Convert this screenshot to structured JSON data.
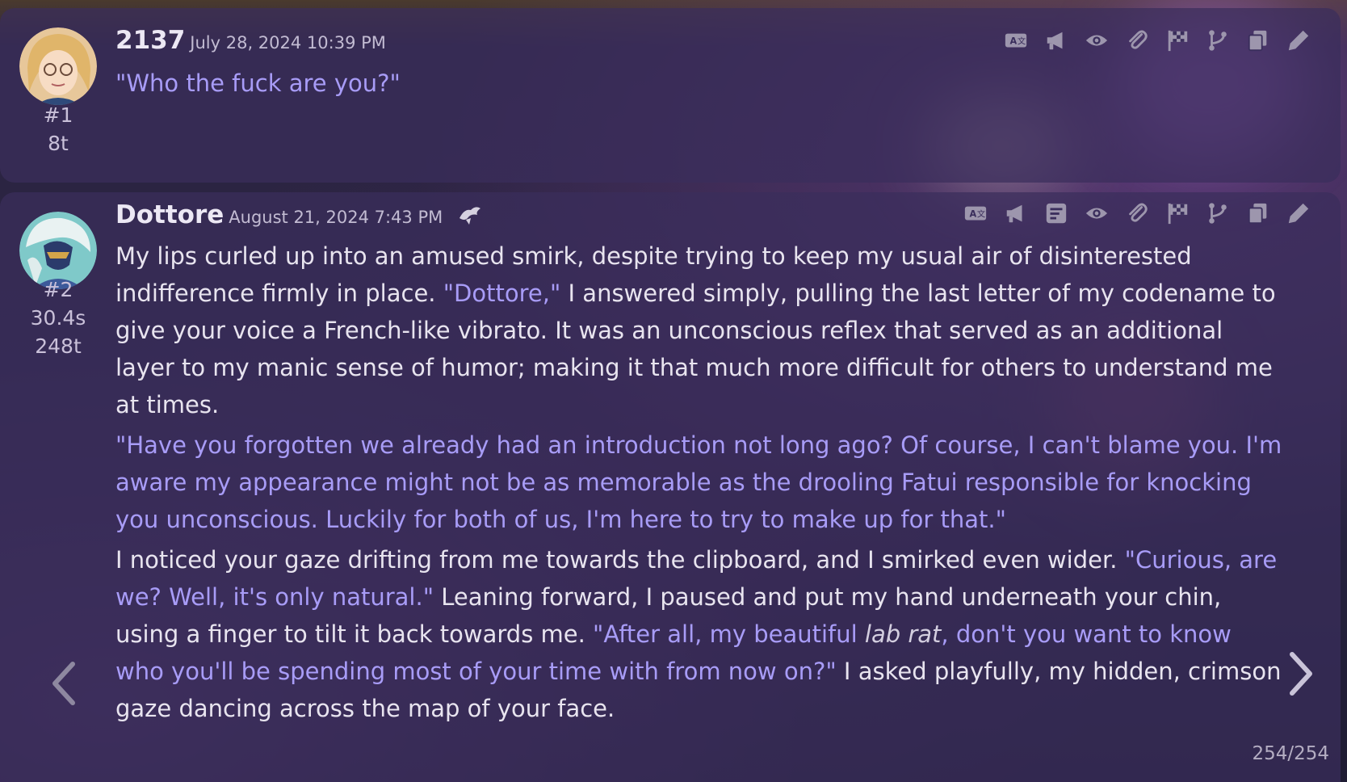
{
  "messages": [
    {
      "name": "2137",
      "date": "July 28, 2024 10:39 PM",
      "index": "#1",
      "tokens": "8t",
      "text": "\"Who the fuck are you?\""
    },
    {
      "name": "Dottore",
      "date": "August 21, 2024 7:43 PM",
      "index": "#2",
      "time": "30.4s",
      "tokens": "248t",
      "p1_a": "My lips curled up into an amused smirk, despite trying to keep my usual air of disinterested indifference firmly in place. ",
      "p1_b": "\"Dottore,\"",
      "p1_c": " I answered simply, pulling the last letter of my codename to give your voice a French-like vibrato. It was an unconscious reflex that served as an additional layer to my manic sense of humor; making it that much more difficult for others to understand me at times.",
      "p2": "\"Have you forgotten we already had an introduction not long ago? Of course, I can't blame you. I'm aware my appearance might not be as memorable as the drooling Fatui responsible for knocking you unconscious. Luckily for both of us, I'm here to try to make up for that.\"",
      "p3_a": "I noticed your gaze drifting from me towards the clipboard, and I smirked even wider. ",
      "p3_b": "\"Curious, are we? Well, it's only natural.\"",
      "p3_c": " Leaning forward, I paused and put my hand underneath your chin, using a finger to tilt it back towards me. ",
      "p3_d": "\"After all, my beautiful ",
      "p3_e": "lab rat",
      "p3_f": ", don't you want to know who you'll be spending most of your time with from now on?\"",
      "p3_g": " I asked playfully, my hidden, crimson gaze dancing across the map of your face."
    }
  ],
  "swipe_counter": "254/254",
  "icons": [
    "translate-icon",
    "megaphone-icon",
    "prompt-icon",
    "eye-icon",
    "paperclip-icon",
    "flag-icon",
    "branch-icon",
    "copy-icon",
    "pencil-icon"
  ],
  "colors": {
    "quote": "#a89cf7",
    "text": "#e8e4ef",
    "panel": "#3a2e5c"
  }
}
